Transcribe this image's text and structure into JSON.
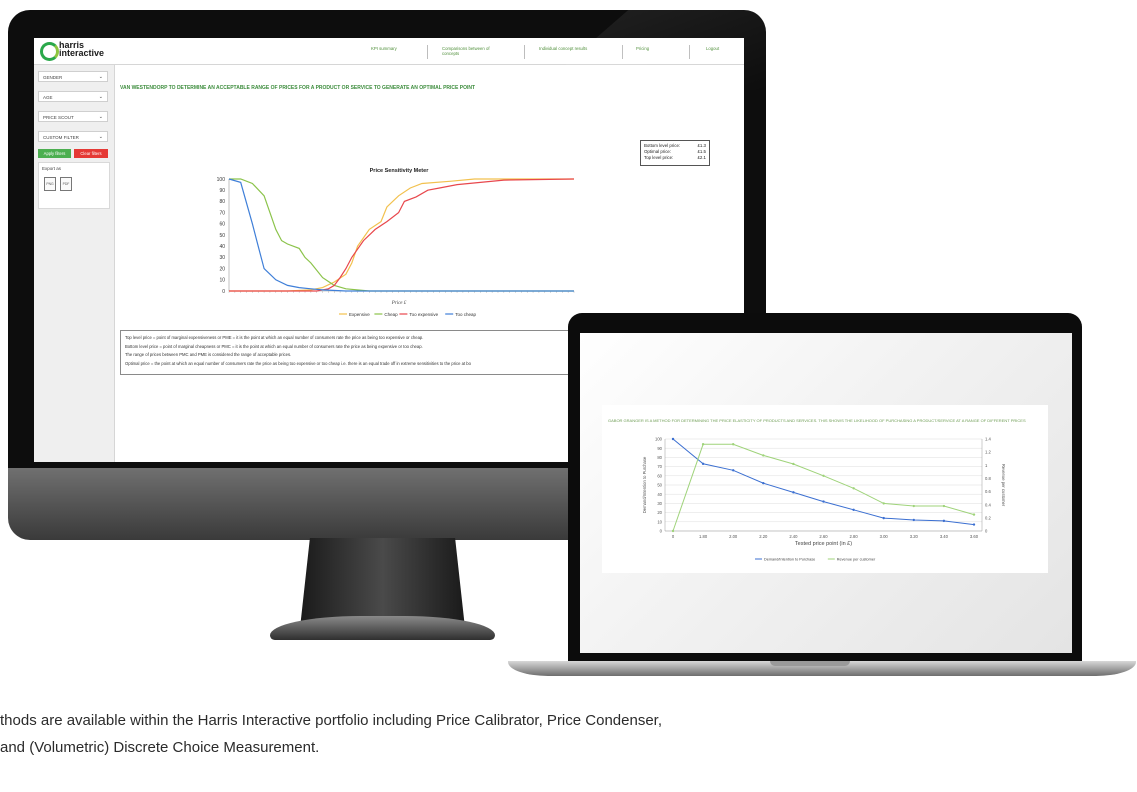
{
  "monitor": {
    "header": {
      "logo_line1": "harris",
      "logo_line2": "interactive",
      "nav": [
        {
          "label": "KPI summary"
        },
        {
          "label": "Comparisons between of concepts"
        },
        {
          "label": "Individual concept results"
        },
        {
          "label": "Pricing"
        },
        {
          "label": "Logout"
        }
      ]
    },
    "sidebar": {
      "dropdowns": [
        "GENDER",
        "AGE",
        "PRICE SCOUT",
        "CUSTOM FILTER"
      ],
      "apply_label": "Apply filters",
      "clear_label": "Clear filters",
      "export_label": "Export as",
      "export_formats": [
        "PNG",
        "PDF"
      ]
    },
    "page_title": "VAN WESTENDORP TO DETERMINE AN ACCEPTABLE RANGE OF PRICES FOR A PRODUCT OR SERVICE TO GENERATE AN OPTIMAL PRICE POINT",
    "price_box": [
      {
        "label": "Bottom level price:",
        "value": "£1.3"
      },
      {
        "label": "Optimal price:",
        "value": "£1.5"
      },
      {
        "label": "Top level price:",
        "value": "£2.1"
      }
    ],
    "definitions": [
      "Top level price = point of marginal expensiveness or PME = it is the point at which an equal number of consumers rate the price as being too expensive or cheap.",
      "Bottom level price = point of marginal cheapness or PMC = it is the point at which an equal number of consumers rate the price as being expensive or too cheap.",
      "The range of prices between PMC and PME is considered the range of acceptable prices.",
      "Optimal price = the point at which an equal number of consumers rate the price as being too expensive or too cheap i.e. there is an equal trade off in extreme sensitivities to the price at bo"
    ]
  },
  "laptop": {
    "title": "GABOR GRANGER IS A METHOD FOR DETERMINING THE PRICE ELASTICITY OF PRODUCTS AND SERVICES. THIS SHOWS THE LIKELIHOOD OF PURCHASING A PRODUCT/SERVICE AT A RANGE OF DIFFERENT PRICES"
  },
  "caption": {
    "line1": "thods are available within the Harris Interactive portfolio including Price Calibrator, Price Condenser,",
    "line2": "and (Volumetric) Discrete Choice Measurement."
  },
  "colors": {
    "expensive": "#f2c14e",
    "cheap": "#8bc34a",
    "too_expensive": "#e8474c",
    "too_cheap": "#3f7fd8",
    "brand_green": "#2aa84a",
    "demand": "#3b6fd1",
    "revenue": "#9fd37a"
  },
  "chart_data": [
    {
      "type": "line",
      "title": "Price Sensitivity Meter",
      "xlabel": "Price £",
      "ylabel": "",
      "ylim": [
        0,
        100
      ],
      "yticks": [
        0,
        10,
        20,
        30,
        40,
        50,
        60,
        70,
        80,
        90,
        100
      ],
      "x_points": 60,
      "legend_position": "bottom",
      "series": [
        {
          "name": "Expensive",
          "color": "#f2c14e",
          "points": [
            [
              0,
              0
            ],
            [
              10,
              0
            ],
            [
              14,
              1
            ],
            [
              16,
              3
            ],
            [
              18,
              8
            ],
            [
              20,
              15
            ],
            [
              21,
              25
            ],
            [
              22,
              40
            ],
            [
              24,
              55
            ],
            [
              26,
              62
            ],
            [
              27,
              75
            ],
            [
              29,
              85
            ],
            [
              31,
              92
            ],
            [
              33,
              96
            ],
            [
              38,
              98
            ],
            [
              42,
              100
            ],
            [
              59,
              100
            ]
          ]
        },
        {
          "name": "Cheap",
          "color": "#8bc34a",
          "points": [
            [
              0,
              100
            ],
            [
              2,
              100
            ],
            [
              4,
              96
            ],
            [
              6,
              85
            ],
            [
              8,
              55
            ],
            [
              9,
              45
            ],
            [
              10,
              42
            ],
            [
              12,
              38
            ],
            [
              13,
              30
            ],
            [
              14,
              25
            ],
            [
              16,
              12
            ],
            [
              18,
              5
            ],
            [
              20,
              2
            ],
            [
              24,
              0
            ],
            [
              59,
              0
            ]
          ]
        },
        {
          "name": "Too expensive",
          "color": "#e8474c",
          "points": [
            [
              0,
              0
            ],
            [
              15,
              0
            ],
            [
              17,
              2
            ],
            [
              18,
              5
            ],
            [
              19,
              12
            ],
            [
              20,
              20
            ],
            [
              21,
              30
            ],
            [
              23,
              45
            ],
            [
              25,
              55
            ],
            [
              27,
              62
            ],
            [
              29,
              70
            ],
            [
              30,
              80
            ],
            [
              32,
              84
            ],
            [
              34,
              90
            ],
            [
              36,
              92
            ],
            [
              39,
              95
            ],
            [
              43,
              97
            ],
            [
              47,
              99
            ],
            [
              59,
              100
            ]
          ]
        },
        {
          "name": "Too cheap",
          "color": "#3f7fd8",
          "points": [
            [
              0,
              100
            ],
            [
              2,
              97
            ],
            [
              4,
              60
            ],
            [
              5,
              40
            ],
            [
              6,
              20
            ],
            [
              8,
              10
            ],
            [
              10,
              5
            ],
            [
              12,
              3
            ],
            [
              14,
              2
            ],
            [
              16,
              1
            ],
            [
              20,
              0
            ],
            [
              59,
              0
            ]
          ]
        }
      ]
    },
    {
      "type": "line",
      "title": "",
      "xlabel": "Tested price point (in £)",
      "ylabel": "Demand/Intention to Purchase",
      "y2label": "Revenue per customer",
      "categories": [
        "0",
        "1.80",
        "2.00",
        "2.20",
        "2.40",
        "2.60",
        "2.80",
        "3.00",
        "3.20",
        "3.40",
        "3.60"
      ],
      "ylim": [
        0,
        100
      ],
      "yticks": [
        0,
        10,
        20,
        30,
        40,
        50,
        60,
        70,
        80,
        90,
        100
      ],
      "y2lim": [
        0,
        1.4
      ],
      "y2ticks": [
        0,
        0.2,
        0.4,
        0.6,
        0.8,
        1.0,
        1.2,
        1.4
      ],
      "legend_position": "bottom",
      "series": [
        {
          "name": "Demand/Intention to Purchase",
          "axis": "left",
          "color": "#3b6fd1",
          "values": [
            100,
            73,
            66,
            52,
            42,
            32,
            23,
            14,
            12,
            11,
            7
          ]
        },
        {
          "name": "Revenue per customer",
          "axis": "right",
          "color": "#9fd37a",
          "values": [
            0,
            1.32,
            1.32,
            1.15,
            1.02,
            0.84,
            0.65,
            0.42,
            0.38,
            0.38,
            0.25
          ]
        }
      ]
    }
  ]
}
